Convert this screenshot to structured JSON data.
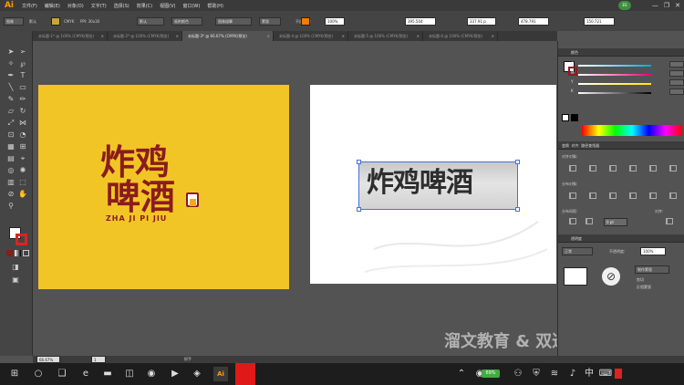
{
  "menubar": {
    "logo": "Ai",
    "items": [
      "文件(F)",
      "编辑(E)",
      "对象(O)",
      "文字(T)",
      "选择(S)",
      "效果(C)",
      "视图(V)",
      "窗口(W)",
      "帮助(H)"
    ],
    "user": "ES",
    "controls": [
      "—",
      "❐",
      "✕"
    ]
  },
  "controlbar": {
    "mode": "图像",
    "preset_label": "默认",
    "color_mode": "CMYK",
    "ppi": "PPI: 30x30",
    "profile": "默认",
    "preset2": "吸附颜色",
    "trace_preset": "图像描摹",
    "mask": "蒙版",
    "opacity_label": "不透明度:",
    "opacity": "100%",
    "x_value": "395.504",
    "y_value": "337.91 p",
    "w_value": "478.791",
    "h_value": "150.721"
  },
  "tabs": [
    {
      "label": "未标题-1* @ 100% (CMYK/预览)",
      "active": false
    },
    {
      "label": "未标题-2* @ 100% (CMYK/预览)",
      "active": false
    },
    {
      "label": "未标题-3* @ 66.67% (CMYK/预览)",
      "active": true
    },
    {
      "label": "未标题-4 @ 100% (CMYK/预览)",
      "active": false
    },
    {
      "label": "未标题-5 @ 100% (CMYK/预览)",
      "active": false
    },
    {
      "label": "未标题-6 @ 100% (CMYK/预览)",
      "active": false
    }
  ],
  "artwork": {
    "line1": "炸鸡",
    "line2": "啤酒",
    "pinyin": "ZHA JI PI JIU",
    "photo_text": "炸鸡啤酒"
  },
  "panels": {
    "color": "颜色",
    "channels": [
      "C",
      "M",
      "Y",
      "K"
    ],
    "align_tabs": [
      "变换",
      "对齐",
      "路径查找器"
    ],
    "align_objects": "对齐对象:",
    "distribute_objects": "分布对象:",
    "distribute_spacing": "分布间距:",
    "align_to": "对齐:",
    "spacing_value": "0 pt",
    "transparency_tab": "透明度",
    "blend_mode": "正常",
    "opacity_label": "不透明度:",
    "opacity": "100%",
    "make_mask": "制作蒙版",
    "clip": "剪切",
    "invert_mask": "反相蒙版"
  },
  "status": {
    "zoom": "66.67%",
    "page": "1",
    "tool": "抓手"
  },
  "taskbar": {
    "battery": "69%",
    "time": ""
  },
  "watermark": "溜文教育 & 双迁素材",
  "colors": {
    "yellow_artboard": "#f2c526",
    "logo_red": "#8a1c1c",
    "accent_orange": "#ff9a00"
  }
}
